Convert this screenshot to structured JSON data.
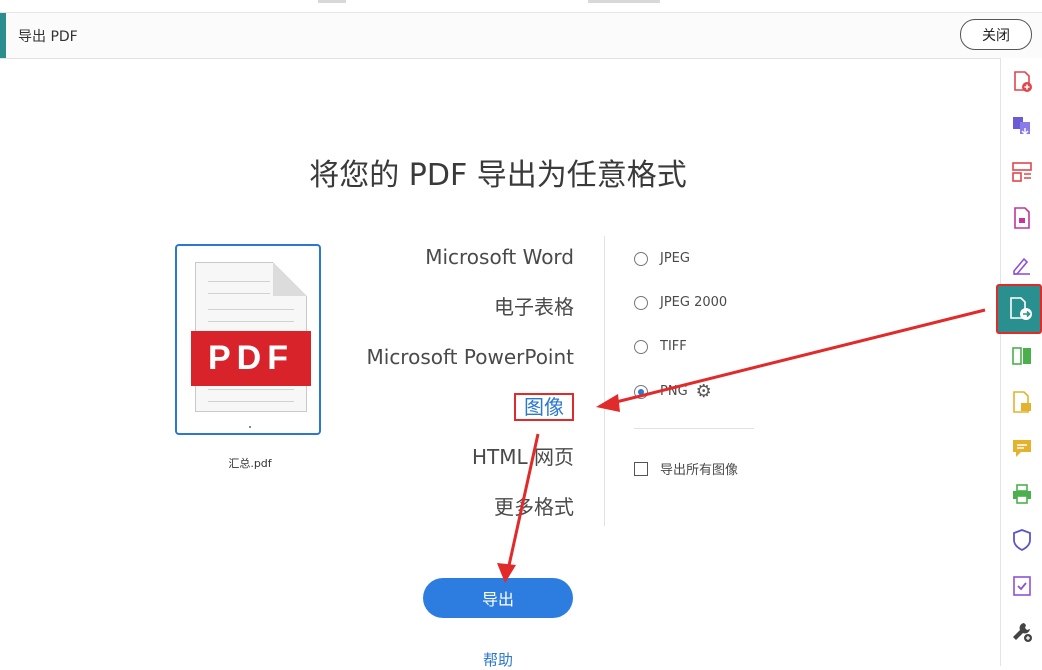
{
  "header": {
    "title": "导出 PDF",
    "close_label": "关闭"
  },
  "main": {
    "heading": "将您的 PDF 导出为任意格式",
    "file": {
      "name": "汇总.pdf",
      "badge": "PDF"
    },
    "formats": [
      {
        "label": "Microsoft Word",
        "selected": false
      },
      {
        "label": "电子表格",
        "selected": false
      },
      {
        "label": "Microsoft PowerPoint",
        "selected": false
      },
      {
        "label": "图像",
        "selected": true
      },
      {
        "label": "HTML 网页",
        "selected": false
      },
      {
        "label": "更多格式",
        "selected": false
      }
    ],
    "image_options": [
      {
        "label": "JPEG",
        "selected": false
      },
      {
        "label": "JPEG 2000",
        "selected": false
      },
      {
        "label": "TIFF",
        "selected": false
      },
      {
        "label": "PNG",
        "selected": true,
        "has_settings": true
      }
    ],
    "export_all_images": {
      "label": "导出所有图像",
      "checked": false
    },
    "export_label": "导出",
    "help_label": "帮助"
  },
  "right_rail": [
    {
      "icon": "create-pdf-icon",
      "color": "#e0474c"
    },
    {
      "icon": "combine-files-icon",
      "color": "#6b5bd6"
    },
    {
      "icon": "organize-pages-icon",
      "color": "#e0474c"
    },
    {
      "icon": "edit-pdf-icon",
      "color": "#c2379b"
    },
    {
      "icon": "fill-sign-icon",
      "color": "#8d53d6"
    },
    {
      "icon": "export-pdf-icon",
      "color": "#2a8f8f",
      "active": true
    },
    {
      "icon": "compare-icon",
      "color": "#4bb04b"
    },
    {
      "icon": "send-review-icon",
      "color": "#e5b22e"
    },
    {
      "icon": "comment-icon",
      "color": "#e5b22e"
    },
    {
      "icon": "print-production-icon",
      "color": "#4bb04b"
    },
    {
      "icon": "protect-icon",
      "color": "#5a55c9"
    },
    {
      "icon": "certificates-icon",
      "color": "#8d53d6"
    },
    {
      "icon": "more-tools-icon",
      "color": "#444444"
    }
  ]
}
